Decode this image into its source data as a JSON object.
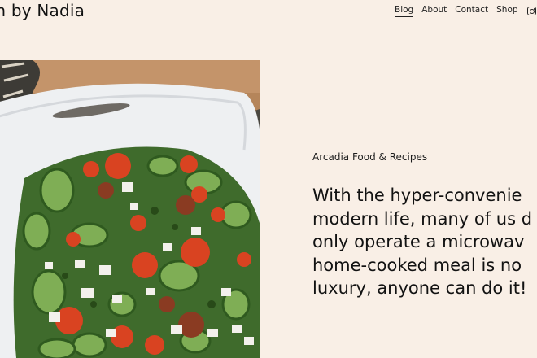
{
  "header": {
    "site_title": "on by Nadia",
    "nav": [
      {
        "label": "Blog",
        "active": true
      },
      {
        "label": "About",
        "active": false
      },
      {
        "label": "Contact",
        "active": false
      },
      {
        "label": "Shop",
        "active": false
      }
    ],
    "social_icon": "instagram-icon"
  },
  "hero": {
    "image": "salad-bowl-photo"
  },
  "content": {
    "eyebrow": "Arcadia Food & Recipes",
    "headline_lines": [
      "With the hyper-convenie",
      "modern life, many of us d",
      "only operate a microwav",
      "home-cooked meal is no",
      "luxury, anyone can do it!"
    ]
  },
  "colors": {
    "background": "#f9efe6",
    "text": "#121212"
  }
}
